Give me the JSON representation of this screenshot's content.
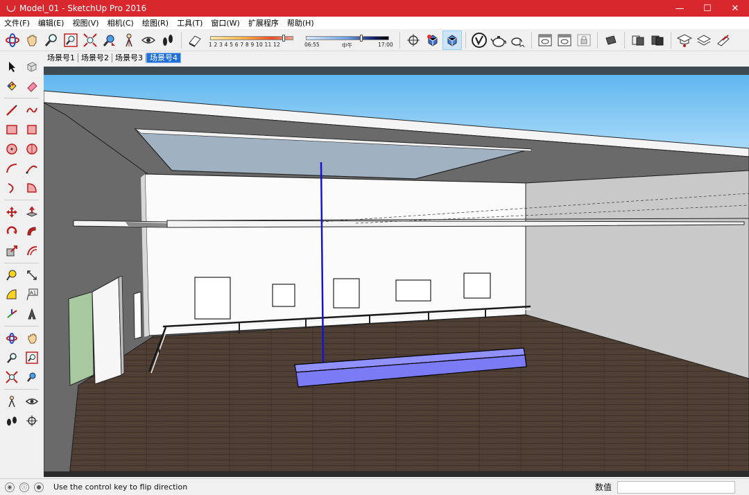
{
  "window": {
    "title": "Model_01 - SketchUp Pro 2016",
    "minimize": "—",
    "maximize": "☐",
    "close": "✕"
  },
  "menu": [
    "文件(F)",
    "编辑(E)",
    "视图(V)",
    "相机(C)",
    "绘图(R)",
    "工具(T)",
    "窗口(W)",
    "扩展程序",
    "帮助(H)"
  ],
  "shadow": {
    "month_ticks": "1  2  3  4  5  6  7  8  9  10 11 12",
    "time_start": "06:55",
    "time_mid": "中午",
    "time_end": "17:00"
  },
  "scenes": [
    {
      "label": "场景号1",
      "active": false
    },
    {
      "label": "场景号2",
      "active": false
    },
    {
      "label": "场景号3",
      "active": false
    },
    {
      "label": "场景号4",
      "active": true
    }
  ],
  "palette": {
    "text_tool_glyph": "A1"
  },
  "status": {
    "message": "Use the control key to flip direction",
    "value_label": "数值",
    "value": ""
  },
  "colors": {
    "titlebar": "#d8282e",
    "sky": "#78c3f2",
    "floor": "#4e3e33",
    "selected_box": "#8080ff",
    "blue_axis": "#1515d0"
  }
}
